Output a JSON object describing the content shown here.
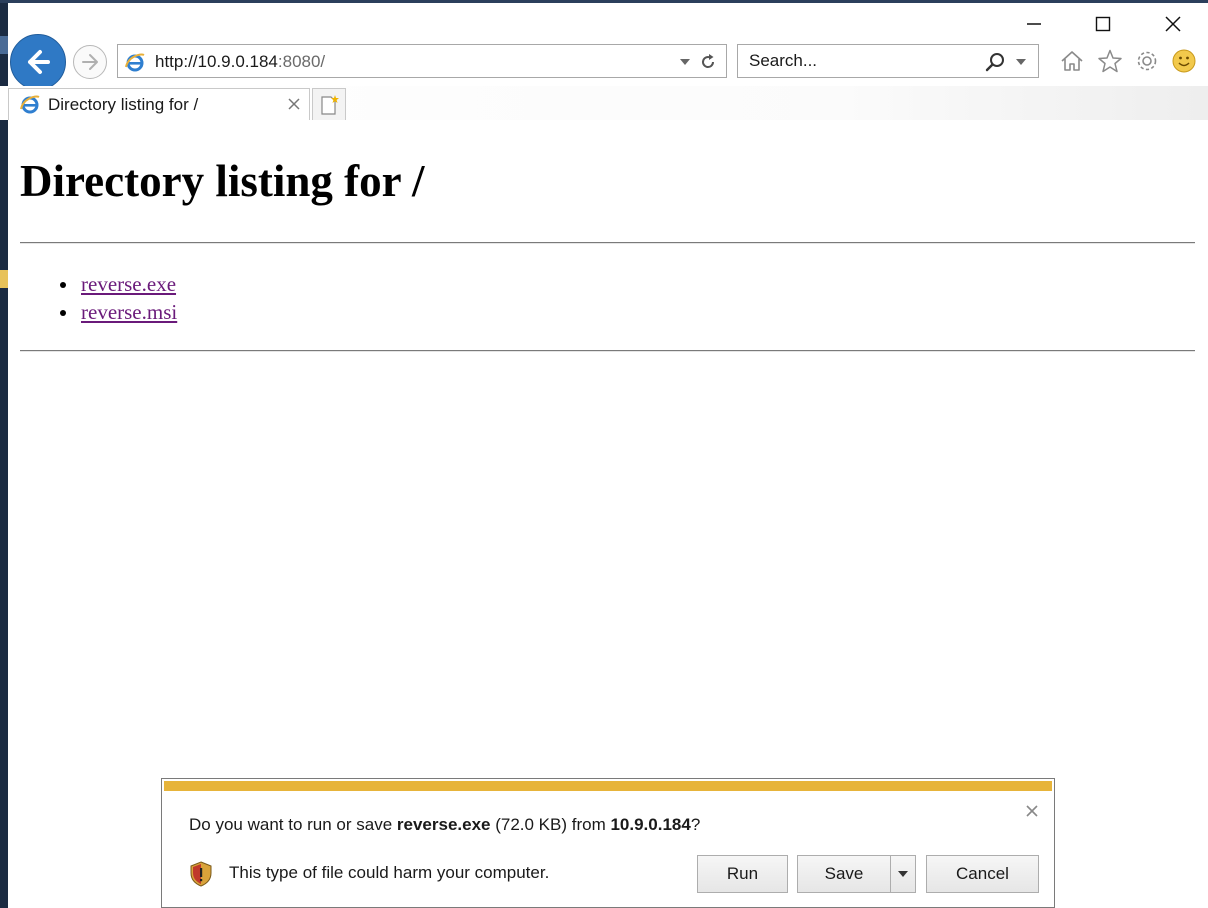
{
  "window": {
    "minimize_label": "Minimize",
    "maximize_label": "Maximize",
    "close_label": "Close"
  },
  "navigation": {
    "address_host": "http://10.9.0.184",
    "address_port": ":8080/",
    "search_placeholder": "Search..."
  },
  "toolbar": {
    "icons": [
      "home-icon",
      "favorites-star-icon",
      "settings-gear-icon",
      "feedback-smiley-icon"
    ]
  },
  "tab": {
    "title": "Directory listing for /"
  },
  "page": {
    "heading": "Directory listing for /",
    "files": [
      {
        "name": "reverse.exe"
      },
      {
        "name": "reverse.msi"
      }
    ]
  },
  "download_bar": {
    "question_prefix": "Do you want to run or save ",
    "file_name": "reverse.exe",
    "file_size": " (72.0 KB) from ",
    "source": "10.9.0.184",
    "question_suffix": "?",
    "warning": "This type of file could harm your computer.",
    "run_label": "Run",
    "save_label": "Save",
    "cancel_label": "Cancel",
    "accent_color": "#e7b43a"
  }
}
